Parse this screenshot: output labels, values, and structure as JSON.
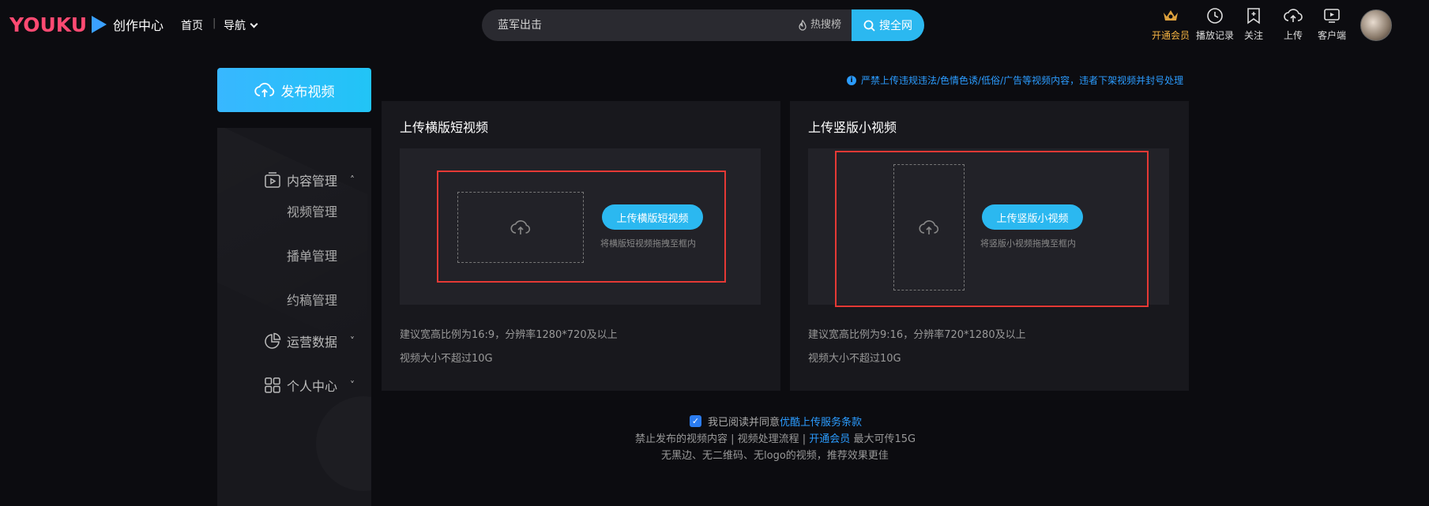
{
  "header": {
    "logo_text": "YOUKU",
    "logo_subtitle": "创作中心",
    "nav_home": "首页",
    "nav_separator": "|",
    "nav_guide": "导航",
    "search_value": "蓝军出击",
    "hot_label": "热搜榜",
    "search_button": "搜全网",
    "tools": [
      {
        "label": "开通会员",
        "icon": "crown-icon"
      },
      {
        "label": "播放记录",
        "icon": "clock-icon"
      },
      {
        "label": "关注",
        "icon": "bookmark-icon"
      },
      {
        "label": "上传",
        "icon": "cloud-upload-icon"
      },
      {
        "label": "客户端",
        "icon": "tv-icon"
      }
    ]
  },
  "sidebar": {
    "publish_button": "发布视频",
    "sections": [
      {
        "label": "内容管理",
        "arrow": "˄",
        "icon": "content-icon"
      },
      {
        "label": "运营数据",
        "arrow": "˅",
        "icon": "pie-chart-icon"
      },
      {
        "label": "个人中心",
        "arrow": "˅",
        "icon": "grid-icon"
      }
    ],
    "sub_items": [
      "视频管理",
      "播单管理",
      "约稿管理"
    ]
  },
  "notice": {
    "icon_text": "i",
    "text": "严禁上传违规违法/色情色诱/低俗/广告等视频内容，违者下架视频并封号处理"
  },
  "cards": [
    {
      "title": "上传横版短视频",
      "button": "上传横版短视频",
      "hint": "将横版短视频拖拽至框内",
      "spec_ratio": "建议宽高比例为16:9，分辨率1280*720及以上",
      "spec_size": "视频大小不超过10G"
    },
    {
      "title": "上传竖版小视频",
      "button": "上传竖版小视频",
      "hint": "将竖版小视频拖拽至框内",
      "spec_ratio": "建议宽高比例为9:16，分辨率720*1280及以上",
      "spec_size": "视频大小不超过10G"
    }
  ],
  "footer": {
    "agree_prefix": "我已阅读并同意",
    "agree_link": "优酷上传服务条款",
    "line2_a": "禁止发布的视频内容 | 视频处理流程 | ",
    "line2_link": "开通会员",
    "line2_b": " 最大可传15G",
    "line3": "无黑边、无二维码、无logo的视频，推荐效果更佳"
  },
  "colors": {
    "accent": "#2bb8f0",
    "brand_pink": "#ff4a72",
    "highlight_red": "#e53935",
    "vip_gold": "#f5b342"
  }
}
